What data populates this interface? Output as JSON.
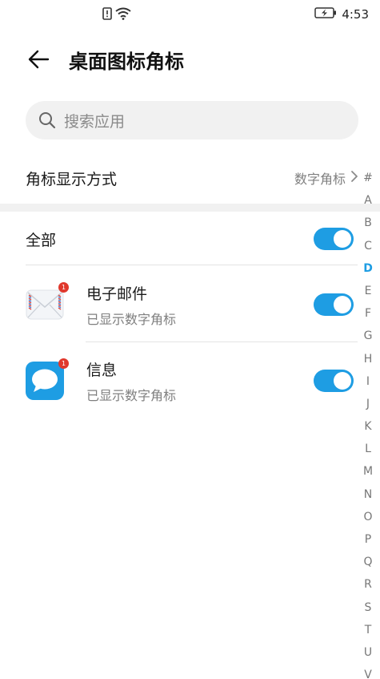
{
  "status_bar": {
    "time": "4:53",
    "icons": [
      "sim-alert-icon",
      "wifi-icon",
      "battery-charging-icon"
    ]
  },
  "header": {
    "back_icon": "arrow-left-icon",
    "title": "桌面图标角标"
  },
  "search": {
    "placeholder": "搜索应用",
    "icon": "search-icon"
  },
  "badge_style": {
    "label": "角标显示方式",
    "value": "数字角标",
    "chevron": "chevron-right-icon"
  },
  "all_row": {
    "label": "全部",
    "enabled": true
  },
  "apps": [
    {
      "name": "电子邮件",
      "status": "已显示数字角标",
      "badge": "1",
      "icon": "email-icon",
      "enabled": true
    },
    {
      "name": "信息",
      "status": "已显示数字角标",
      "badge": "1",
      "icon": "message-icon",
      "enabled": true
    }
  ],
  "alphabet_index": {
    "letters": [
      "#",
      "A",
      "B",
      "C",
      "D",
      "E",
      "F",
      "G",
      "H",
      "I",
      "J",
      "K",
      "L",
      "M",
      "N",
      "O",
      "P",
      "Q",
      "R",
      "S",
      "T",
      "U",
      "V"
    ],
    "active": "D"
  },
  "colors": {
    "accent": "#1e9de3",
    "badge": "#e0382c",
    "secondary_text": "#7f7f7f",
    "search_bg": "#f1f1f1"
  }
}
